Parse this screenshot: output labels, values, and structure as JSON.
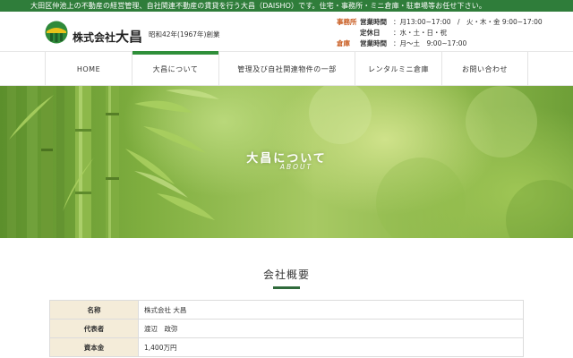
{
  "topbar": {
    "text": "大田区仲池上の不動産の経営管理、自社関連不動産の賃貸を行う大昌（DAISHO）です。住宅・事務所・ミニ倉庫・駐車場等お任せ下さい。"
  },
  "header": {
    "company_prefix": "株式会社",
    "company_name": "大昌",
    "founded": "昭和42年(1967年)創業",
    "hours": [
      {
        "tag": "事務所",
        "label": "営業時間",
        "value": "：月13:00~17:00　/　火・木・金 9:00~17:00"
      },
      {
        "tag": "",
        "label": "定休日",
        "value": "：水・土・日・祝"
      },
      {
        "tag": "倉庫",
        "label": "営業時間",
        "value": "：月〜土　9:00~17:00"
      }
    ]
  },
  "nav": {
    "items": [
      {
        "label": "HOME"
      },
      {
        "label": "大昌について"
      },
      {
        "label": "管理及び自社関連物件の一部"
      },
      {
        "label": "レンタルミニ倉庫"
      },
      {
        "label": "お問い合わせ"
      }
    ],
    "active_index": 1
  },
  "hero": {
    "title": "大昌について",
    "subtitle": "ABOUT"
  },
  "section": {
    "title": "会社概要"
  },
  "company_table": {
    "rows": [
      {
        "key": "名称",
        "value": "株式会社 大昌"
      },
      {
        "key": "代表者",
        "value": "渡辺　政弥"
      },
      {
        "key": "資本金",
        "value": "1,400万円"
      }
    ]
  },
  "colors": {
    "brand_green": "#2f7d3a",
    "accent_orange": "#c85a1e",
    "table_key_bg": "#f4ecd9"
  }
}
